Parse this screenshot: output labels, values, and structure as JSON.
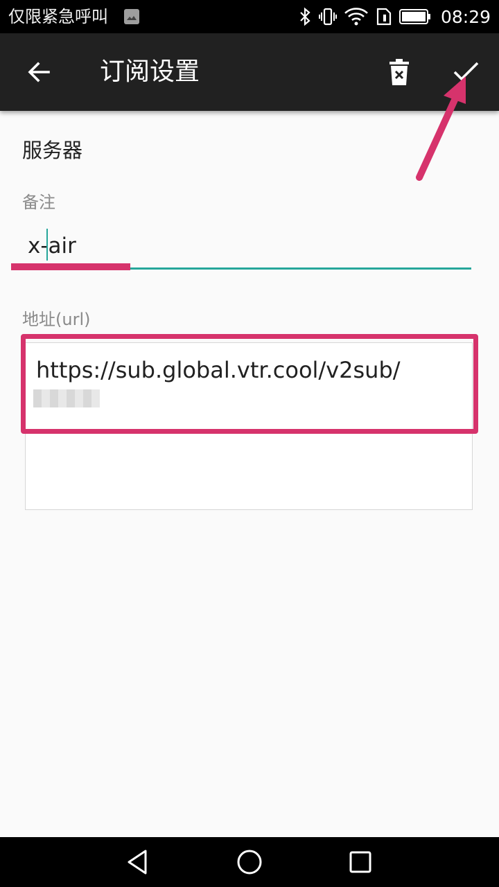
{
  "status_bar": {
    "carrier": "仅限紧急呼叫",
    "time": "08:29",
    "icons": [
      "image-icon",
      "bluetooth-icon",
      "vibrate-icon",
      "wifi-icon",
      "sim-icon",
      "battery-icon"
    ]
  },
  "toolbar": {
    "title": "订阅设置",
    "back_icon": "arrow-left-icon",
    "delete_icon": "delete-icon",
    "confirm_icon": "check-icon"
  },
  "form": {
    "section_title": "服务器",
    "remark_label": "备注",
    "remark_value": "x-air",
    "url_label": "地址(url)",
    "url_value": "https://sub.global.vtr.cool/v2sub/"
  },
  "colors": {
    "toolbar_bg": "#212121",
    "accent": "#26a69a",
    "annotation": "#d6336c"
  },
  "nav_bar": {
    "icons": [
      "nav-back-icon",
      "nav-home-icon",
      "nav-recent-icon"
    ]
  }
}
